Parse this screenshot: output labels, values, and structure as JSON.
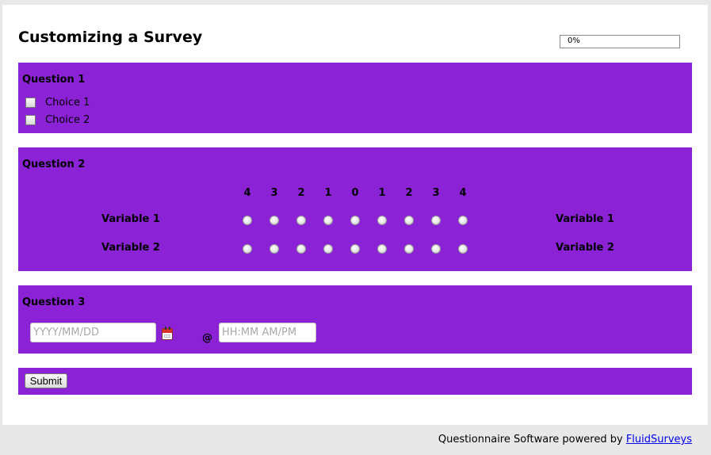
{
  "survey": {
    "title": "Customizing a Survey",
    "progress": {
      "text": "0%",
      "value": 0
    }
  },
  "q1": {
    "label": "Question 1",
    "choices": [
      {
        "label": "Choice 1"
      },
      {
        "label": "Choice 2"
      }
    ]
  },
  "q2": {
    "label": "Question 2",
    "scale": [
      "4",
      "3",
      "2",
      "1",
      "0",
      "1",
      "2",
      "3",
      "4"
    ],
    "rows": [
      {
        "left": "Variable 1",
        "right": "Variable 1"
      },
      {
        "left": "Variable 2",
        "right": "Variable 2"
      }
    ]
  },
  "q3": {
    "label": "Question 3",
    "date_placeholder": "YYYY/MM/DD",
    "at": "@",
    "time_placeholder": "HH:MM AM/PM"
  },
  "submit": {
    "label": "Submit"
  },
  "footer": {
    "text": "Questionnaire Software powered by",
    "link": "FluidSurveys"
  },
  "colors": {
    "accent": "#8b22d6"
  }
}
